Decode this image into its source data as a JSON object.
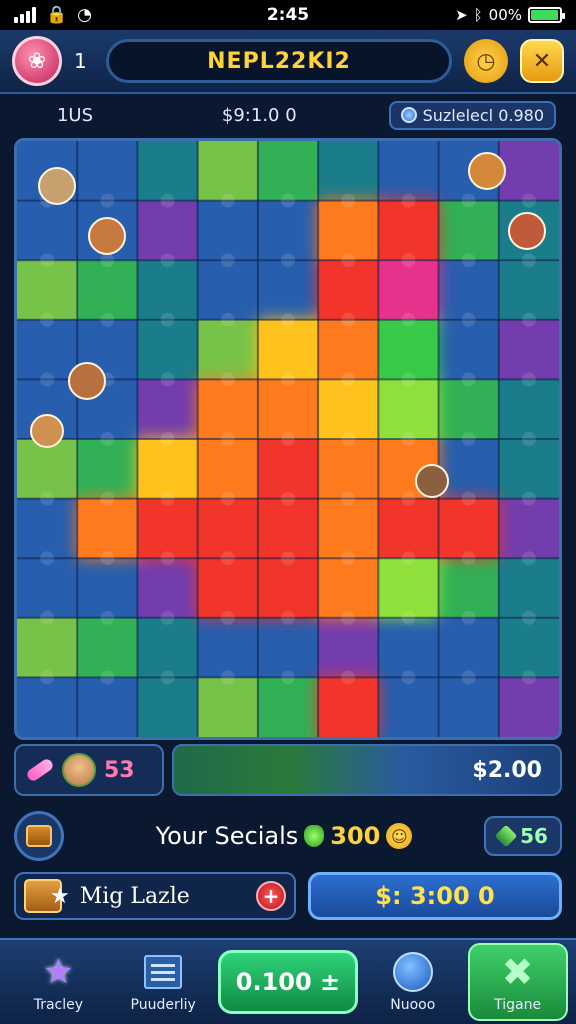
{
  "status": {
    "time": "2:45",
    "battery": "00%",
    "battery_level": 0.95
  },
  "header": {
    "level": "1",
    "title": "NEPL22KI2"
  },
  "info": {
    "left": "1US",
    "middle": "$9:1.0 0",
    "right": "Suzlelecl 0.980"
  },
  "board": {
    "colors": {
      "bg": "#1c4b86",
      "orange": "#ff7a1a",
      "red": "#f2362a",
      "yellow": "#ffc21a",
      "green": "#37c94a",
      "lime": "#8fe03a",
      "pink": "#e6338a",
      "teal": "#1c8a8c",
      "blue": "#2a63b8",
      "purple": "#8a3ab8"
    },
    "icons": [
      "dragon-icon",
      "monster-icon",
      "hero-icon",
      "crate-icon",
      "squirrel-icon"
    ]
  },
  "hint": {
    "count": "53"
  },
  "tray": {
    "amount": "$2.00"
  },
  "socials": {
    "label": "Your Secials",
    "value": "300",
    "gems": "56"
  },
  "puzzle": {
    "label": "Mig Lazle",
    "price": "$: 3:00 0"
  },
  "nav": {
    "items": [
      {
        "label": "Tracley",
        "icon": "star-icon"
      },
      {
        "label": "Puuderliy",
        "icon": "list-icon"
      },
      {
        "label": "0.100 ±",
        "icon": "center-icon"
      },
      {
        "label": "Nuooo",
        "icon": "globe-icon"
      },
      {
        "label": "Tigane",
        "icon": "x-icon"
      }
    ]
  }
}
